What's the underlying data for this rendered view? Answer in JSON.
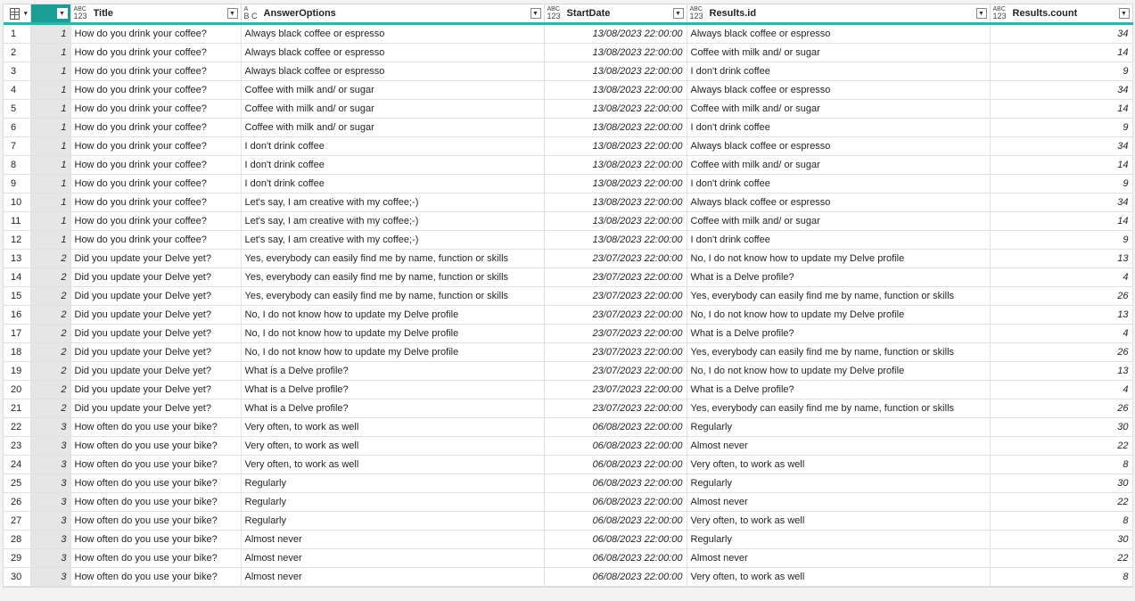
{
  "columns": [
    {
      "label": "",
      "type_top": "",
      "type_bottom": ""
    },
    {
      "label": "Title",
      "type_top": "ABC",
      "type_bottom": "123"
    },
    {
      "label": "AnswerOptions",
      "type_top": "A",
      "type_bottom": "B C"
    },
    {
      "label": "StartDate",
      "type_top": "ABC",
      "type_bottom": "123"
    },
    {
      "label": "Results.id",
      "type_top": "ABC",
      "type_bottom": "123"
    },
    {
      "label": "Results.count",
      "type_top": "ABC",
      "type_bottom": "123"
    }
  ],
  "rows": [
    [
      "1",
      "How do you drink your coffee?",
      "Always black coffee or espresso",
      "13/08/2023 22:00:00",
      "Always black coffee or espresso",
      "34"
    ],
    [
      "1",
      "How do you drink your coffee?",
      "Always black coffee or espresso",
      "13/08/2023 22:00:00",
      "Coffee with milk and/ or sugar",
      "14"
    ],
    [
      "1",
      "How do you drink your coffee?",
      "Always black coffee or espresso",
      "13/08/2023 22:00:00",
      "I don't drink coffee",
      "9"
    ],
    [
      "1",
      "How do you drink your coffee?",
      "Coffee with milk and/ or sugar",
      "13/08/2023 22:00:00",
      "Always black coffee or espresso",
      "34"
    ],
    [
      "1",
      "How do you drink your coffee?",
      "Coffee with milk and/ or sugar",
      "13/08/2023 22:00:00",
      "Coffee with milk and/ or sugar",
      "14"
    ],
    [
      "1",
      "How do you drink your coffee?",
      "Coffee with milk and/ or sugar",
      "13/08/2023 22:00:00",
      "I don't drink coffee",
      "9"
    ],
    [
      "1",
      "How do you drink your coffee?",
      "I don't drink coffee",
      "13/08/2023 22:00:00",
      "Always black coffee or espresso",
      "34"
    ],
    [
      "1",
      "How do you drink your coffee?",
      "I don't drink coffee",
      "13/08/2023 22:00:00",
      "Coffee with milk and/ or sugar",
      "14"
    ],
    [
      "1",
      "How do you drink your coffee?",
      "I don't drink coffee",
      "13/08/2023 22:00:00",
      "I don't drink coffee",
      "9"
    ],
    [
      "1",
      "How do you drink your coffee?",
      "Let's say, I am creative with my coffee;-)",
      "13/08/2023 22:00:00",
      "Always black coffee or espresso",
      "34"
    ],
    [
      "1",
      "How do you drink your coffee?",
      "Let's say, I am creative with my coffee;-)",
      "13/08/2023 22:00:00",
      "Coffee with milk and/ or sugar",
      "14"
    ],
    [
      "1",
      "How do you drink your coffee?",
      "Let's say, I am creative with my coffee;-)",
      "13/08/2023 22:00:00",
      "I don't drink coffee",
      "9"
    ],
    [
      "2",
      "Did you update your Delve yet?",
      "Yes, everybody can easily find me by name, function or skills",
      "23/07/2023 22:00:00",
      "No, I do not know how to update my Delve profile",
      "13"
    ],
    [
      "2",
      "Did you update your Delve yet?",
      "Yes, everybody can easily find me by name, function or skills",
      "23/07/2023 22:00:00",
      "What is a Delve profile?",
      "4"
    ],
    [
      "2",
      "Did you update your Delve yet?",
      "Yes, everybody can easily find me by name, function or skills",
      "23/07/2023 22:00:00",
      "Yes, everybody can easily find me by name, function or skills",
      "26"
    ],
    [
      "2",
      "Did you update your Delve yet?",
      "No, I do not know how to update my Delve profile",
      "23/07/2023 22:00:00",
      "No, I do not know how to update my Delve profile",
      "13"
    ],
    [
      "2",
      "Did you update your Delve yet?",
      "No, I do not know how to update my Delve profile",
      "23/07/2023 22:00:00",
      "What is a Delve profile?",
      "4"
    ],
    [
      "2",
      "Did you update your Delve yet?",
      "No, I do not know how to update my Delve profile",
      "23/07/2023 22:00:00",
      "Yes, everybody can easily find me by name, function or skills",
      "26"
    ],
    [
      "2",
      "Did you update your Delve yet?",
      "What is a Delve profile?",
      "23/07/2023 22:00:00",
      "No, I do not know how to update my Delve profile",
      "13"
    ],
    [
      "2",
      "Did you update your Delve yet?",
      "What is a Delve profile?",
      "23/07/2023 22:00:00",
      "What is a Delve profile?",
      "4"
    ],
    [
      "2",
      "Did you update your Delve yet?",
      "What is a Delve profile?",
      "23/07/2023 22:00:00",
      "Yes, everybody can easily find me by name, function or skills",
      "26"
    ],
    [
      "3",
      "How often do you use your bike?",
      "Very often, to work as well",
      "06/08/2023 22:00:00",
      "Regularly",
      "30"
    ],
    [
      "3",
      "How often do you use your bike?",
      "Very often, to work as well",
      "06/08/2023 22:00:00",
      "Almost never",
      "22"
    ],
    [
      "3",
      "How often do you use your bike?",
      "Very often, to work as well",
      "06/08/2023 22:00:00",
      "Very often, to work as well",
      "8"
    ],
    [
      "3",
      "How often do you use your bike?",
      "Regularly",
      "06/08/2023 22:00:00",
      "Regularly",
      "30"
    ],
    [
      "3",
      "How often do you use your bike?",
      "Regularly",
      "06/08/2023 22:00:00",
      "Almost never",
      "22"
    ],
    [
      "3",
      "How often do you use your bike?",
      "Regularly",
      "06/08/2023 22:00:00",
      "Very often, to work as well",
      "8"
    ],
    [
      "3",
      "How often do you use your bike?",
      "Almost never",
      "06/08/2023 22:00:00",
      "Regularly",
      "30"
    ],
    [
      "3",
      "How often do you use your bike?",
      "Almost never",
      "06/08/2023 22:00:00",
      "Almost never",
      "22"
    ],
    [
      "3",
      "How often do you use your bike?",
      "Almost never",
      "06/08/2023 22:00:00",
      "Very often, to work as well",
      "8"
    ]
  ],
  "row_numbers": [
    "1",
    "2",
    "3",
    "4",
    "5",
    "6",
    "7",
    "8",
    "9",
    "10",
    "11",
    "12",
    "13",
    "14",
    "15",
    "16",
    "17",
    "18",
    "19",
    "20",
    "21",
    "22",
    "23",
    "24",
    "25",
    "26",
    "27",
    "28",
    "29",
    "30"
  ],
  "icons": {
    "corner": "table-icon",
    "dropdown": "chevron-down-icon"
  },
  "colors": {
    "accent": "#2fb3ae",
    "selected_header": "#1b9e94"
  }
}
